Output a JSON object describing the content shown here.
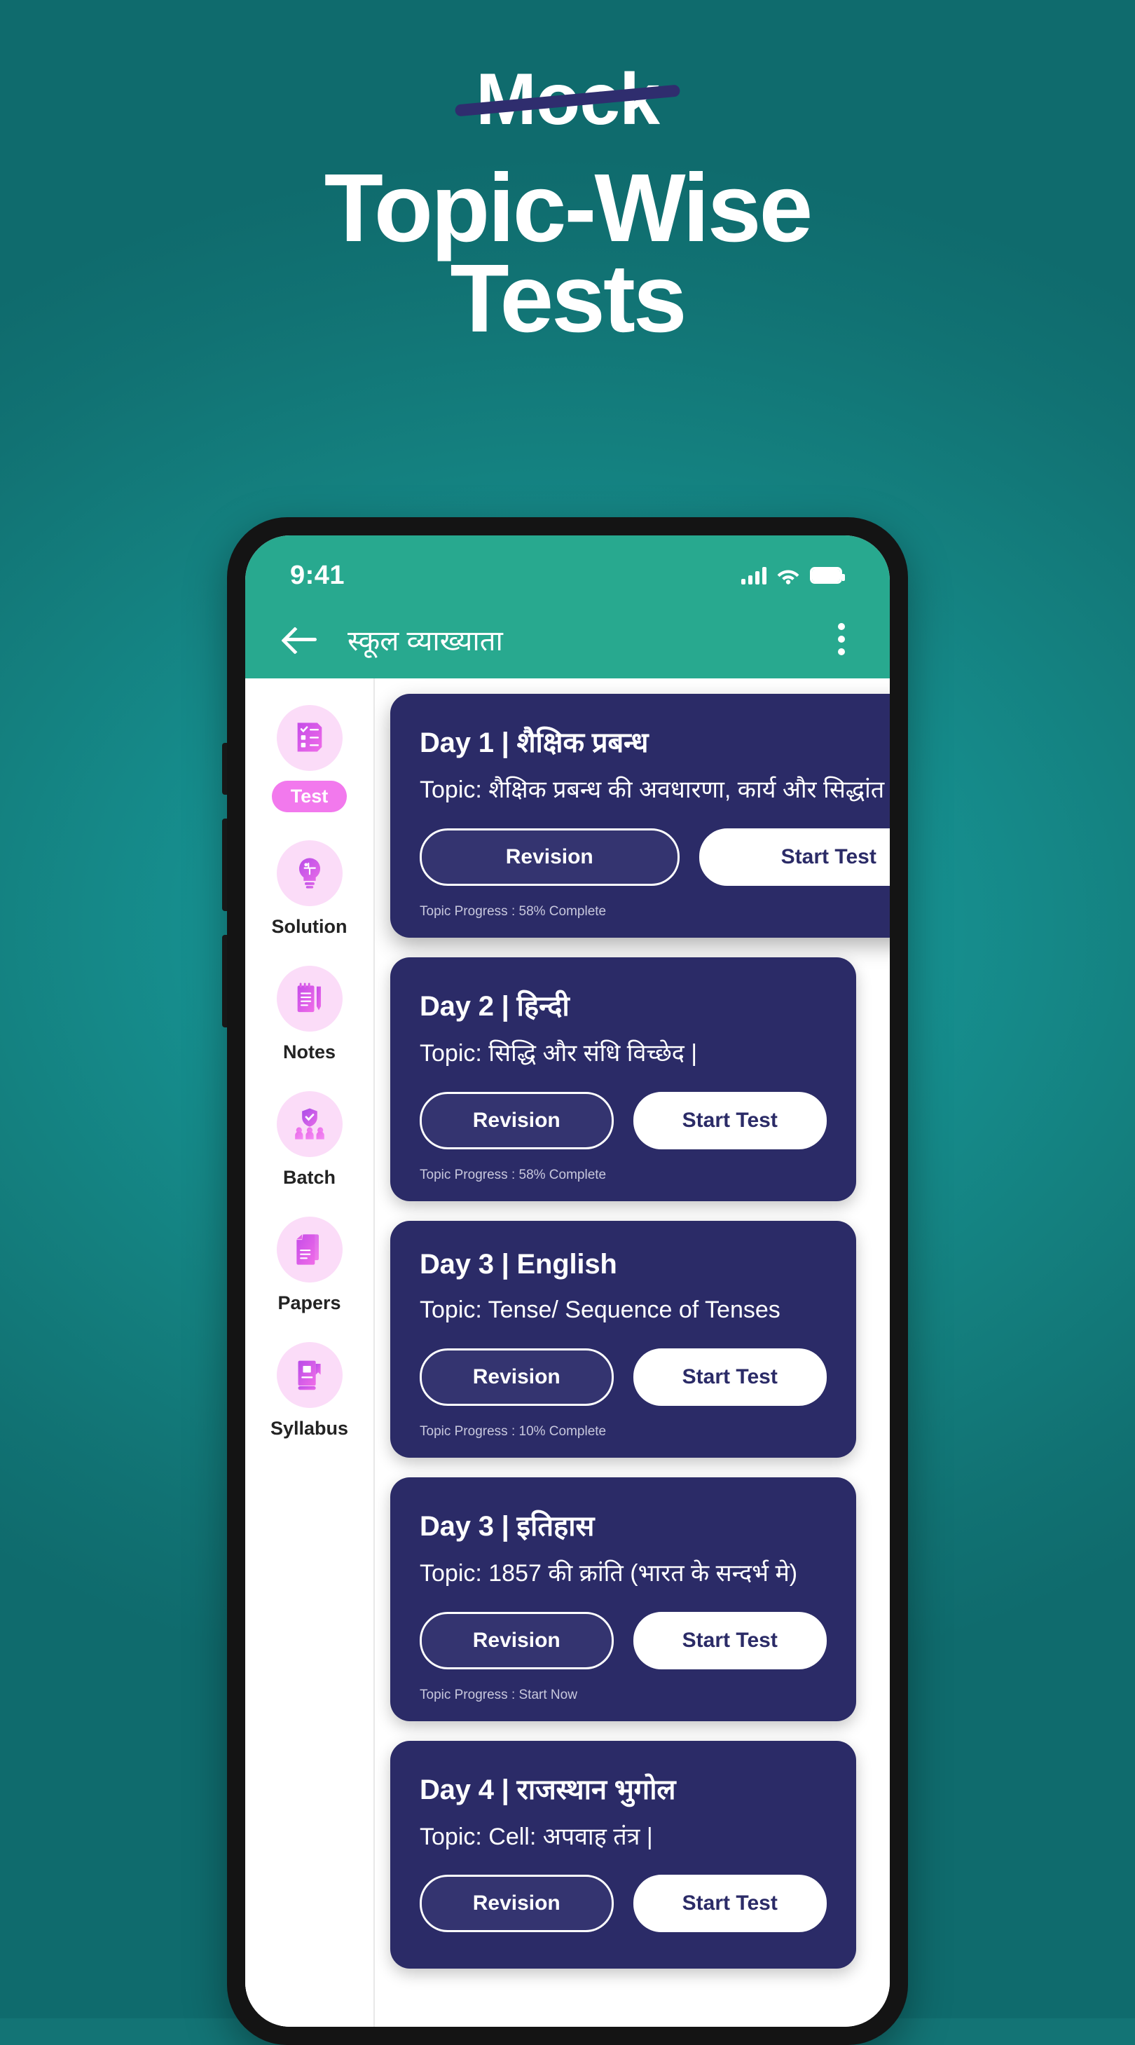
{
  "hero": {
    "strikethrough_word": "Mock",
    "headline_line1": "Topic-Wise",
    "headline_line2": "Tests",
    "strike_color": "#2f2d6e",
    "text_color": "#ffffff"
  },
  "theme": {
    "background_teal": "#137475",
    "appbar_teal": "#28a98f",
    "card_navy": "#2b2b67",
    "accent_pink": "#f279ed",
    "icon_bg_pink": "#fbdcf8"
  },
  "phone": {
    "status_bar": {
      "time": "9:41",
      "icons": [
        "signal-bars-icon",
        "wifi-icon",
        "battery-icon"
      ]
    },
    "app_bar": {
      "back_icon": "back-arrow-icon",
      "title": "स्कूल व्याख्याता",
      "overflow_icon": "kebab-menu-icon"
    }
  },
  "sidebar": {
    "items": [
      {
        "label": "Test",
        "icon": "test-checklist-icon",
        "active": true
      },
      {
        "label": "Solution",
        "icon": "lightbulb-puzzle-icon",
        "active": false
      },
      {
        "label": "Notes",
        "icon": "notepad-pencil-icon",
        "active": false
      },
      {
        "label": "Batch",
        "icon": "shield-people-icon",
        "active": false
      },
      {
        "label": "Papers",
        "icon": "documents-stack-icon",
        "active": false
      },
      {
        "label": "Syllabus",
        "icon": "book-icon",
        "active": false
      }
    ]
  },
  "cards": [
    {
      "title": "Day 1 | शैक्षिक प्रबन्ध",
      "topic": "Topic: शैक्षिक प्रबन्ध की अवधारणा, कार्य और सिद्धांत |",
      "revision_label": "Revision",
      "start_label": "Start Test",
      "progress": "Topic Progress : 58% Complete"
    },
    {
      "title": "Day 2 | हिन्दी",
      "topic": "Topic: सिद्धि और संधि विच्छेद |",
      "revision_label": "Revision",
      "start_label": "Start Test",
      "progress": "Topic Progress : 58% Complete"
    },
    {
      "title": "Day 3 | English",
      "topic": "Topic: Tense/ Sequence of Tenses",
      "revision_label": "Revision",
      "start_label": "Start Test",
      "progress": "Topic Progress : 10% Complete"
    },
    {
      "title": "Day 3 | इतिहास",
      "topic": "Topic: 1857 की क्रांति (भारत के सन्दर्भ मे)",
      "revision_label": "Revision",
      "start_label": "Start Test",
      "progress": "Topic Progress : Start Now"
    },
    {
      "title": "Day 4 | राजस्थान भुगोल",
      "topic": "Topic: Cell: अपवाह तंत्र |",
      "revision_label": "Revision",
      "start_label": "Start Test",
      "progress": ""
    }
  ]
}
